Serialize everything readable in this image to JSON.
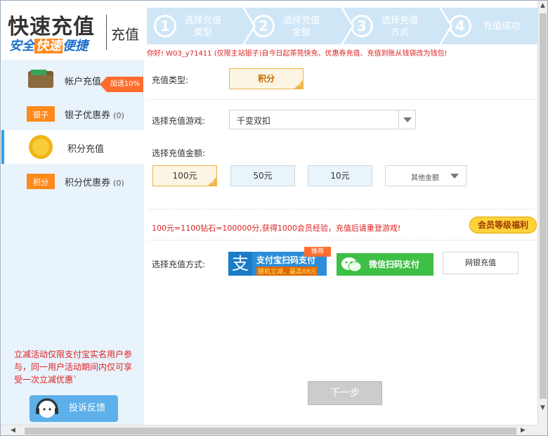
{
  "brand": {
    "title": "快速充值",
    "slogan_a": "安全",
    "slogan_b": "快速",
    "slogan_c": "便捷",
    "sub": "充值"
  },
  "steps": [
    {
      "num": "1",
      "label": "选择充值类型"
    },
    {
      "num": "2",
      "label": "选择充值金额"
    },
    {
      "num": "3",
      "label": "选择充值方式"
    },
    {
      "num": "4",
      "label": "充值成功"
    }
  ],
  "notice": "你好! W03_y71411 (仅限主站银子)自今日起茶苑快充、优惠券充值、充值到账从钱袋改为钱包!",
  "sidebar": {
    "items": [
      {
        "label": "帐户充值",
        "count": "",
        "icon": "wallet-icon"
      },
      {
        "label": "银子优惠券",
        "count": "(0)",
        "icon": "silver-coupon-icon"
      },
      {
        "label": "积分充值",
        "count": "",
        "icon": "gold-coin-icon"
      },
      {
        "label": "积分优惠券",
        "count": "(0)",
        "icon": "points-coupon-icon"
      }
    ],
    "bonus_tag": "加送10%",
    "promo": "立减活动仅限支付宝实名用户参与，同一用户活动期间内仅可享受一次立减优惠`",
    "feedback": "投诉反馈"
  },
  "form": {
    "type_label": "充值类型:",
    "type_value": "积分",
    "game_label": "选择充值游戏:",
    "game_value": "千变双扣",
    "amount_label": "选择充值金额:",
    "amounts": [
      "100元",
      "50元",
      "10元"
    ],
    "other_amount": "其他金额",
    "desc": "100元=1100钻石=100000分,获得1000会员经验，充值后请重登游戏!",
    "vip": "会员等级福利",
    "method_label": "选择充值方式:",
    "alipay": "支付宝扫码支付",
    "alipay_sub": "随机立减，最高88元",
    "alipay_icon": "支",
    "recommend": "推荐",
    "wechat": "微信扫码支付",
    "netbank": "网银充值",
    "next": "下一步"
  },
  "colors": {
    "accent": "#2aa0e8",
    "warning": "#dd2222",
    "orange": "#ff6d2e",
    "step_bg": "#cfe6f7"
  }
}
